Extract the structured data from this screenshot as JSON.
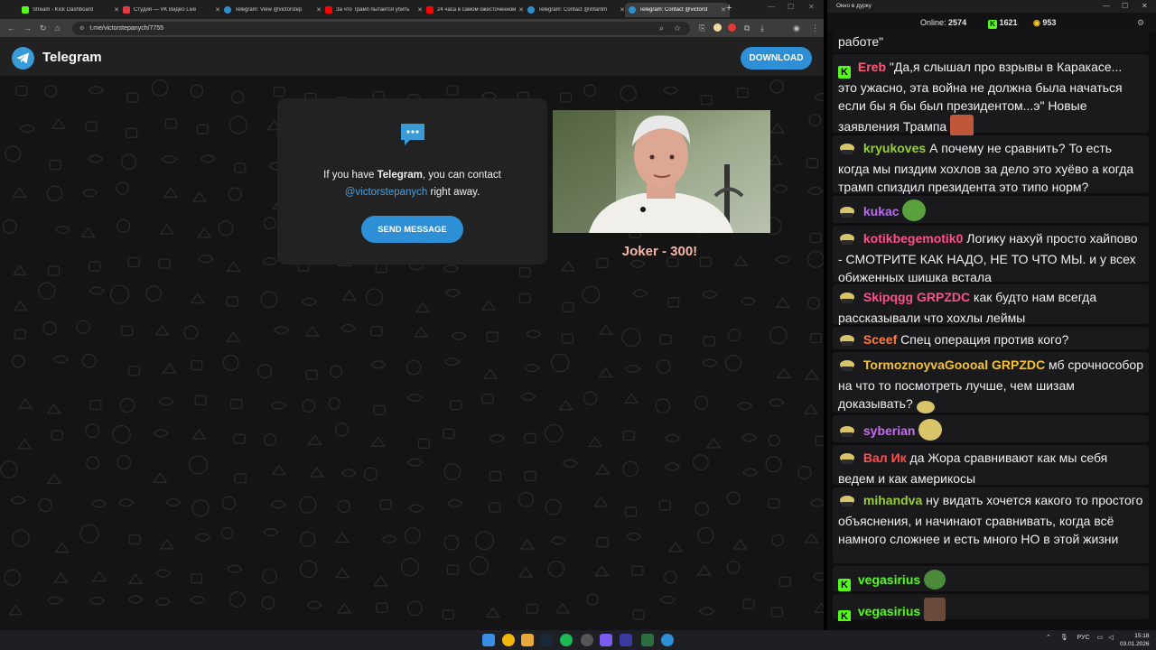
{
  "browser": {
    "tabs": [
      {
        "title": "Stream - Kick Dashboard",
        "favicon_color": "#53fc18"
      },
      {
        "title": "Студия — VK Видео Live",
        "favicon_color": "#e63946"
      },
      {
        "title": "Telegram: View @victorstep",
        "favicon_color": "#2d8fd5"
      },
      {
        "title": "За что Трамп пытается убить",
        "favicon_color": "#ff0000"
      },
      {
        "title": "24 часа в самом ожесточенном",
        "favicon_color": "#ff0000"
      },
      {
        "title": "Telegram: Contact @infantm",
        "favicon_color": "#2d8fd5"
      },
      {
        "title": "Telegram: Contact @victorst",
        "favicon_color": "#2d8fd5"
      }
    ],
    "url": "t.me/victorstepanych/7755"
  },
  "telegram": {
    "brand": "Telegram",
    "download_label": "DOWNLOAD",
    "contact_prefix": "If you have ",
    "contact_app": "Telegram",
    "contact_suffix": ", you can contact",
    "contact_handle": "@victorstepanych",
    "contact_tail": " right away.",
    "send_label": "SEND MESSAGE"
  },
  "video": {
    "caption": "Joker - 300!"
  },
  "chat": {
    "window_title": "Окно в дурку",
    "online_label": "Online:",
    "online_count": "2574",
    "kick_count": "1621",
    "vk_count": "953",
    "messages": [
      {
        "user": "",
        "text": "работе\"",
        "platform": "none",
        "user_color": "#ffffff"
      },
      {
        "user": "Ereb",
        "text": "\"Да,я слышал про взрывы в Каракасе... это ужасно, эта война не должна была начаться если бы я бы был президентом...э\" Новые заявления Трампа",
        "platform": "kick",
        "user_color": "#ff5a7a"
      },
      {
        "user": "kryukoves",
        "text": "А почему не сравнить? То есть когда мы пиздим хохлов за дело это хуёво а когда трамп спиздил президента это типо норм?",
        "platform": "vk",
        "user_color": "#9acd32"
      },
      {
        "user": "kukac",
        "text": "",
        "platform": "vk",
        "user_color": "#b76cf0"
      },
      {
        "user": "kotikbegemotik0",
        "text": "Логику нахуй просто хайпово - СМОТРИТЕ КАК НАДО, НЕ ТО ЧТО МЫ. и у всех обиженных шишка встала",
        "platform": "vk",
        "user_color": "#ff4f8b"
      },
      {
        "user": "Skipqgg",
        "badge": "GRPZDC",
        "text": "как будто нам всегда рассказывали что хохлы леймы",
        "platform": "vk",
        "user_color": "#ff4f8b",
        "badge_color": "#ff4f8b"
      },
      {
        "user": "Sceef",
        "text": "Спец операция против кого?",
        "platform": "vk",
        "user_color": "#ff7a3d"
      },
      {
        "user": "TormoznoyvaGoooal",
        "badge": "GRPZDC",
        "text": "мб срочнособор на что то посмотреть лучше, чем шизам доказывать?",
        "platform": "vk",
        "user_color": "#f4c430",
        "badge_color": "#f4c430"
      },
      {
        "user": "syberian",
        "text": "",
        "platform": "vk",
        "user_color": "#c86cf0"
      },
      {
        "user": "Вал Ик",
        "text": "да Жора сравнивают как мы себя ведем и как америкосы",
        "platform": "vk",
        "user_color": "#ff4f4f"
      },
      {
        "user": "mihandva",
        "text": "ну видать хочется какого то простого объяснения, и начинают сравнивать, когда всё намного сложнее и есть много НО в этой жизни",
        "platform": "vk",
        "user_color": "#9acd32"
      },
      {
        "user": "vegasirius",
        "text": "",
        "platform": "kick",
        "user_color": "#53fc18"
      },
      {
        "user": "vegasirius",
        "text": "",
        "platform": "kick",
        "user_color": "#53fc18"
      }
    ]
  },
  "taskbar": {
    "lang": "РУС",
    "time": "15:18",
    "date": "03.01.2026"
  }
}
